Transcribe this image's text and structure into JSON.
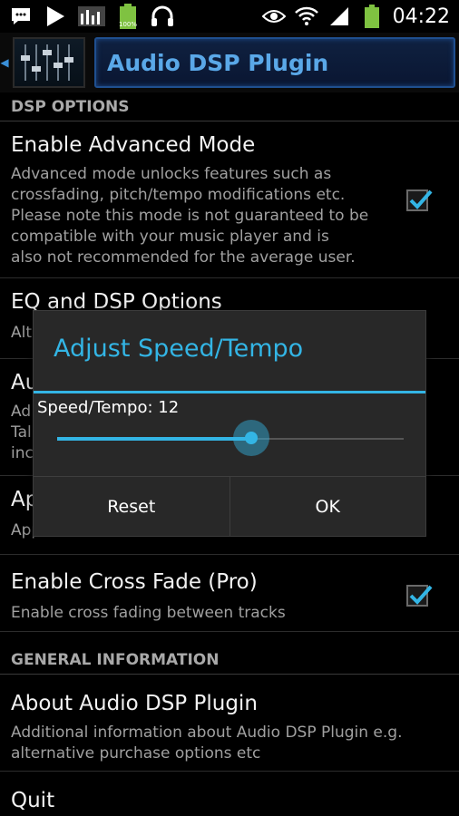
{
  "status_bar": {
    "time": "04:22",
    "battery_percent": "100%",
    "left_icons": [
      "chat-icon",
      "play-icon",
      "equalizer-icon",
      "battery-charging-icon",
      "headphones-icon"
    ],
    "right_icons": [
      "eye-icon",
      "wifi-icon",
      "signal-icon",
      "battery-icon"
    ]
  },
  "action_bar": {
    "title": "Audio DSP Plugin"
  },
  "sections": {
    "dsp_options": "DSP OPTIONS",
    "general_information": "GENERAL INFORMATION"
  },
  "items": {
    "advanced_mode": {
      "title": "Enable Advanced Mode",
      "summary_lines": [
        "Advanced mode unlocks features such as",
        "crossfading, pitch/tempo modifications etc.",
        "Please note this mode is not guaranteed to be",
        "compatible with your music player and is",
        "also not recommended for the average user."
      ],
      "checked": true
    },
    "eq_dsp": {
      "title": "EQ and DSP Options",
      "summary": "Alt"
    },
    "third": {
      "title": "Au",
      "summary_lines": [
        "Ad",
        "Tal",
        "inc"
      ]
    },
    "fourth": {
      "title": "Ap",
      "summary": "App"
    },
    "cross_fade": {
      "title": "Enable Cross Fade (Pro)",
      "summary": "Enable cross fading between tracks",
      "checked": true
    },
    "about": {
      "title": "About Audio DSP Plugin",
      "summary_lines": [
        "Additional information about Audio DSP Plugin e.g.",
        "alternative purchase options etc"
      ]
    },
    "quit": {
      "title": "Quit"
    }
  },
  "dialog": {
    "title": "Adjust Speed/Tempo",
    "label": "Speed/Tempo: 12",
    "slider_value_fraction": 0.56,
    "reset_label": "Reset",
    "ok_label": "OK",
    "accent_color": "#33b5e5"
  }
}
